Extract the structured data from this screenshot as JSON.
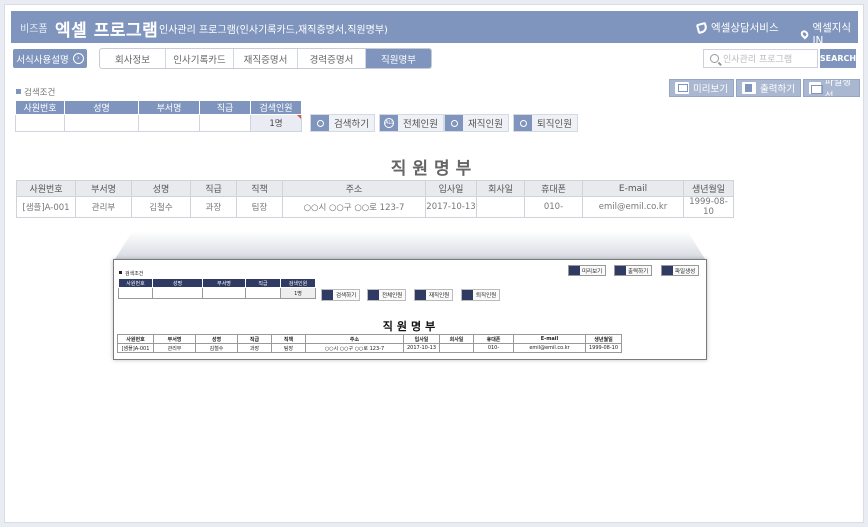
{
  "header": {
    "brand_small": "비즈폼",
    "brand_big": "엑셀 프로그램",
    "subtitle": "인사관리 프로그램(인사기록카드,재직증명서,직원명부)",
    "consult_label": "엑셀상담서비스",
    "knowledge_label": "엑셀지식 IN"
  },
  "nav": {
    "guide_label": "서식사용설명",
    "tabs": [
      "회사정보",
      "인사기록카드",
      "재직증명서",
      "경력증명서",
      "직원명부"
    ],
    "active_tab": "직원명부",
    "search_placeholder": "인사관리 프로그램",
    "search_button": "SEARCH"
  },
  "actions": {
    "preview": "미리보기",
    "print": "출력하기",
    "file_create": "파일생성"
  },
  "search_condition": {
    "label": "검색조건",
    "headers": [
      "사원번호",
      "성명",
      "부서명",
      "직급",
      "검색인원"
    ],
    "count": "1명",
    "buttons": [
      "검색하기",
      "전체인원",
      "재직인원",
      "퇴직인원"
    ]
  },
  "roster": {
    "title": "직원명부",
    "headers": [
      "사원번호",
      "부서명",
      "성명",
      "직급",
      "직책",
      "주소",
      "입사일",
      "회사일",
      "휴대폰",
      "E-mail",
      "생년월일"
    ],
    "rows": [
      [
        "[샘플]A-001",
        "관리부",
        "김철수",
        "과장",
        "팀장",
        "○○시 ○○구 ○○로 123-7",
        "2017-10-13",
        "",
        "010-",
        "emil@emil.co.kr",
        "1999-08-10"
      ]
    ]
  }
}
